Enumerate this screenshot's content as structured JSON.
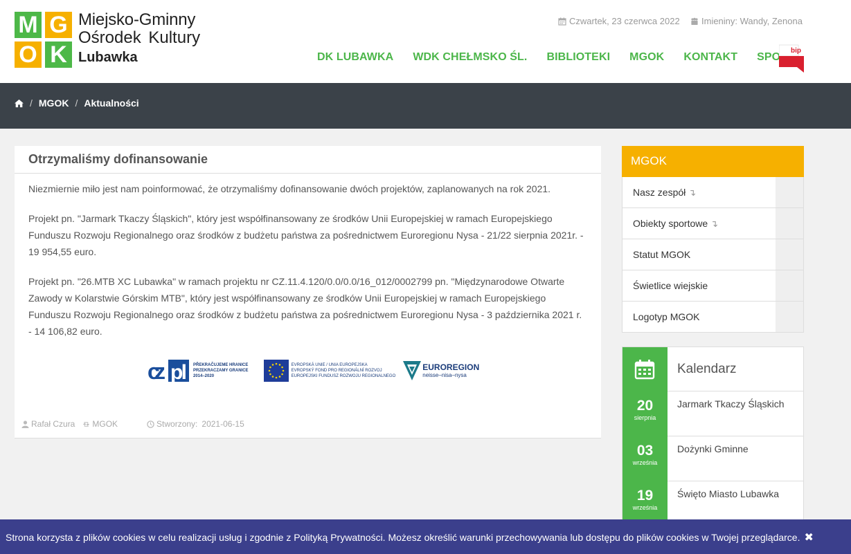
{
  "logo": {
    "letters": [
      "M",
      "G",
      "O",
      "K"
    ],
    "line1": "Miejsko-Gminny",
    "line2": "Ośrodek Kultury",
    "line3": "Lubawka"
  },
  "topinfo": {
    "date": "Czwartek, 23 czerwca 2022",
    "nameday": "Imieniny: Wandy, Zenona"
  },
  "nav": [
    "DK LUBAWKA",
    "WDK CHEŁMSKO ŚL.",
    "BIBLIOTEKI",
    "MGOK",
    "KONTAKT",
    "SPORT"
  ],
  "bip_label": "bip",
  "breadcrumb": {
    "items": [
      "MGOK",
      "Aktualności"
    ]
  },
  "article": {
    "title": "Otrzymaliśmy dofinansowanie",
    "paragraphs": [
      "Niezmiernie miło jest nam poinformować, że otrzymaliśmy dofinansowanie dwóch projektów, zaplanowanych na rok 2021.",
      "Projekt pn. \"Jarmark Tkaczy Śląskich\", który jest współfinansowany ze środków Unii Europejskiej w ramach Europejskiego Funduszu Rozwoju Regionalnego oraz środków z budżetu państwa za pośrednictwem Euroregionu Nysa - 21/22 sierpnia 2021r. - 19 954,55 euro.",
      "Projekt pn. \"26.MTB XC Lubawka\" w ramach projektu nr CZ.11.4.120/0.0/0.0/16_012/0002799 pn. \"Międzynarodowe Otwarte Zawody w Kolarstwie Górskim MTB\", który jest współfinansowany ze środków Unii Europejskiej w ramach Europejskiego Funduszu Rozwoju Regionalnego oraz środków z budżetu państwa za pośrednictwem Euroregionu Nysa - 3 października 2021 r. - 14 106,82 euro."
    ],
    "logos": {
      "czpl": "CZ PL",
      "czpl_text": [
        "PŘEKRAČUJEME HRANICE",
        "PRZEKRACZAMY GRANICE",
        "2014–2020"
      ],
      "eu_text": [
        "EVROPSKÁ UNIE / UNIA EUROPEJSKA",
        "EVROPSKÝ FOND PRO REGIONÁLNÍ ROZVOJ",
        "EUROPEJSKI FUNDUSZ ROZWOJU REGIONALNEGO"
      ],
      "euroregion": "EUROREGION",
      "euroregion_sub": "neisse–nisa–nysa"
    },
    "meta": {
      "author": "Rafał Czura",
      "category": "MGOK",
      "created_label": "Stworzony:",
      "created_date": "2021-06-15"
    }
  },
  "sidebar": {
    "title": "MGOK",
    "items": [
      {
        "label": "Nasz zespół",
        "arrow": "↴"
      },
      {
        "label": "Obiekty sportowe",
        "arrow": "↴"
      },
      {
        "label": "Statut MGOK",
        "arrow": ""
      },
      {
        "label": "Świetlice wiejskie",
        "arrow": ""
      },
      {
        "label": "Logotyp MGOK",
        "arrow": ""
      }
    ]
  },
  "calendar": {
    "title": "Kalendarz",
    "events": [
      {
        "day": "20",
        "month": "sierpnia",
        "title": "Jarmark Tkaczy Śląskich"
      },
      {
        "day": "03",
        "month": "września",
        "title": "Dożynki Gminne"
      },
      {
        "day": "19",
        "month": "września",
        "title": "Święto Miasto Lubawka"
      }
    ]
  },
  "cookie": {
    "text": "Strona korzysta z plików cookies w celu realizacji usług i zgodnie z Polityką Prywatności. Możesz określić warunki przechowywania lub dostępu do plików cookies w Twojej przeglądarce.",
    "close": "✖"
  },
  "colors": {
    "green": "#4cb64a",
    "orange": "#f6b000",
    "dark_band": "#3b4249",
    "cookie_bg": "#3b3f8c",
    "bip_red": "#d9202f"
  }
}
